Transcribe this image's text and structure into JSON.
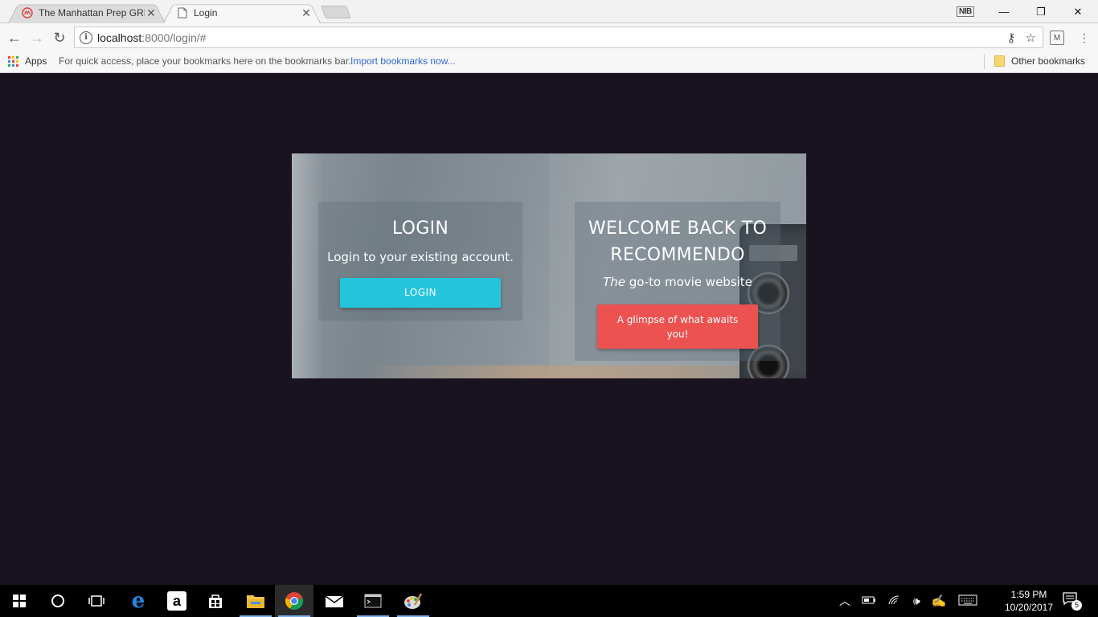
{
  "browser": {
    "tabs": [
      {
        "title": "The Manhattan Prep GRE",
        "active": false
      },
      {
        "title": "Login",
        "active": true
      }
    ],
    "profile_badge": "NIB",
    "url_host": "localhost",
    "url_path": ":8000/login/#",
    "bookmarks_bar": {
      "apps_label": "Apps",
      "hint": "For quick access, place your bookmarks here on the bookmarks bar.",
      "import_link": "Import bookmarks now...",
      "other_label": "Other bookmarks"
    }
  },
  "page": {
    "login_panel": {
      "heading": "LOGIN",
      "subtitle": "Login to your existing account.",
      "button_label": "LOGIN"
    },
    "welcome_panel": {
      "heading": "WELCOME BACK TO RECOMMENDO",
      "tagline_em": "The",
      "tagline_rest": " go-to movie website",
      "button_label": "A glimpse of what awaits you!"
    }
  },
  "taskbar": {
    "time": "1:59 PM",
    "date": "10/20/2017",
    "notification_count": "5"
  },
  "colors": {
    "page_bg": "#19121f",
    "login_button": "#24c4dc",
    "glimpse_button": "#ec5250"
  }
}
